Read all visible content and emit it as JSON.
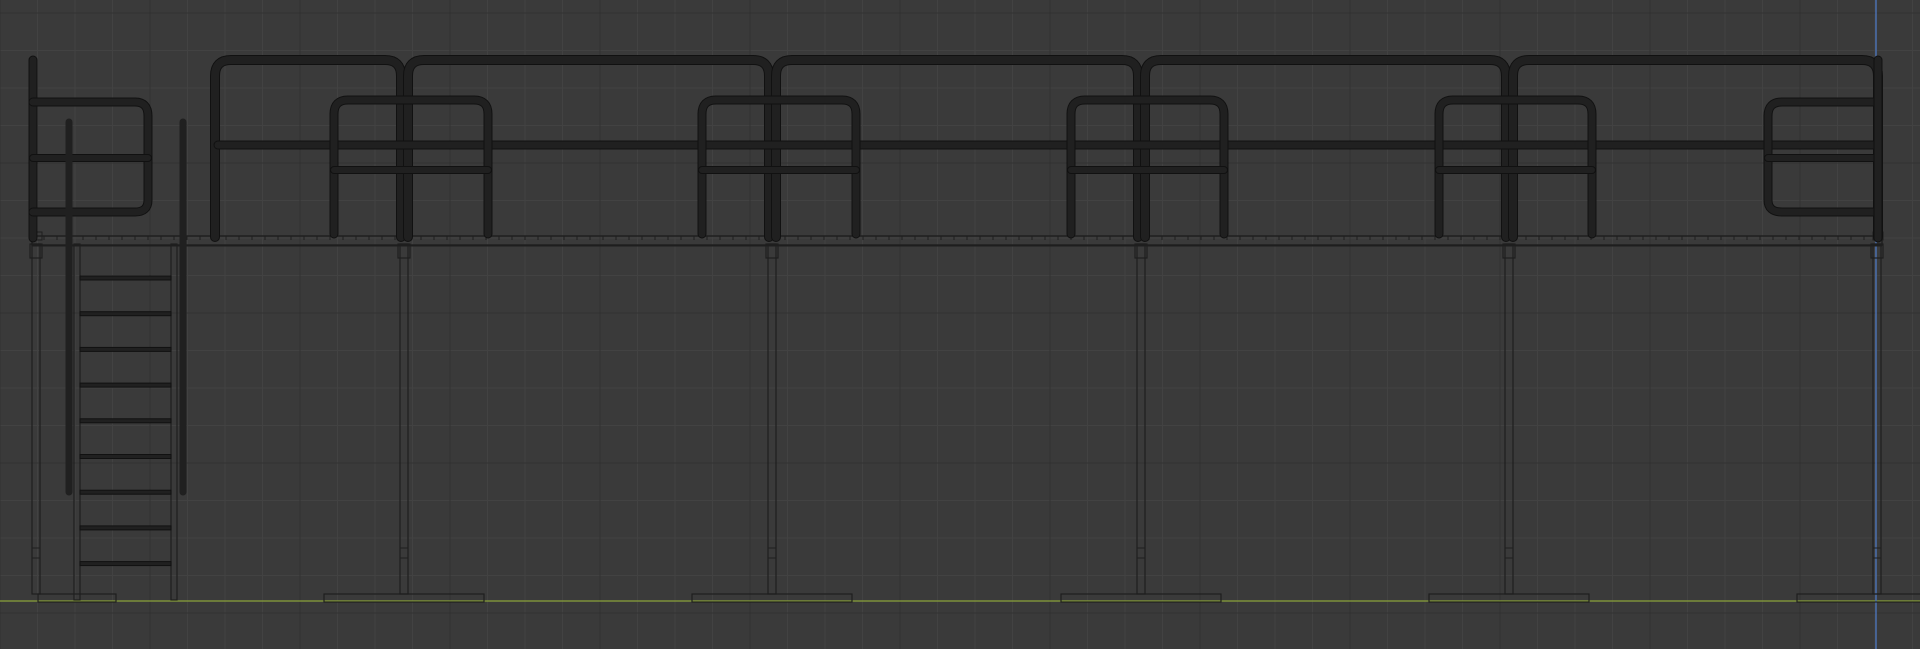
{
  "viewport": {
    "view": "front-orthographic",
    "background_color": "#3a3a3a",
    "grid": true,
    "minor_grid_color": "#424242",
    "major_grid_color": "#313131",
    "ground_axis_color": "#8aa23a",
    "vertical_axis_color": "#4a6fb0"
  },
  "model": {
    "object": "platform-with-ladder",
    "platform_bays": 5,
    "support_posts": 6,
    "ladder_rungs": 9,
    "railing_tube_color": "#202020",
    "frame_line_color": "#1e1e1e"
  }
}
